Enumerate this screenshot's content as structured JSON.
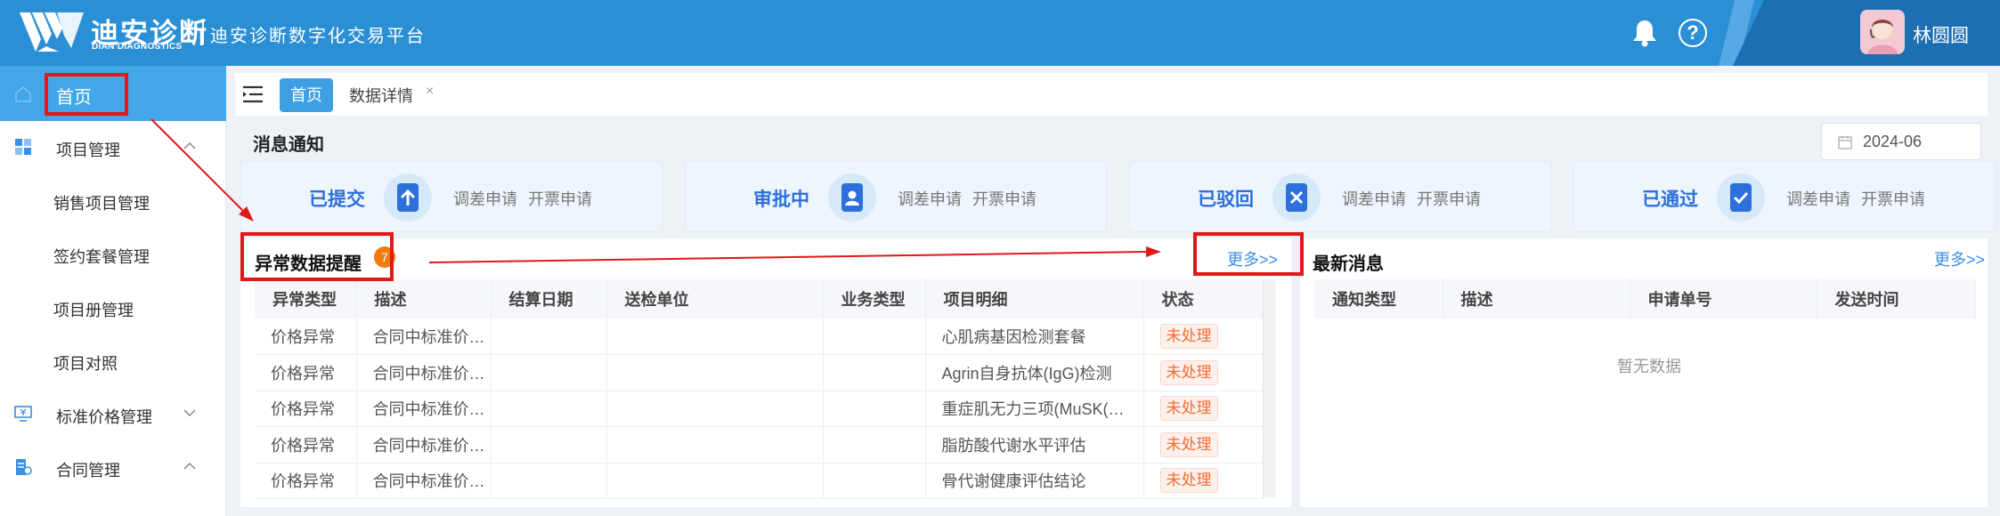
{
  "header": {
    "logo_cn": "迪安诊断",
    "logo_en": "DIAN DIAGNOSTICS",
    "title": "迪安诊断数字化交易平台",
    "user_name": "林圆圆",
    "help_glyph": "?",
    "colors": {
      "header": "#2b8fd6",
      "header_dark": "#1d6fb3",
      "accent": "#3f9fe3"
    }
  },
  "sidebar": {
    "home": "首页",
    "items": [
      {
        "label": "项目管理",
        "icon": "grid-icon",
        "expanded": true
      },
      {
        "label": "销售项目管理"
      },
      {
        "label": "签约套餐管理"
      },
      {
        "label": "项目册管理"
      },
      {
        "label": "项目对照"
      },
      {
        "label": "标准价格管理",
        "icon": "price-icon",
        "expanded": false
      },
      {
        "label": "合同管理",
        "icon": "contract-icon",
        "expanded": true
      }
    ]
  },
  "tabs": [
    {
      "label": "首页",
      "active": true
    },
    {
      "label": "数据详情",
      "close": "×"
    }
  ],
  "messages": {
    "title": "消息通知",
    "date": "2024-06",
    "cards": [
      {
        "label": "已提交",
        "icon": "upload-icon",
        "a": "调差申请",
        "b": "开票申请"
      },
      {
        "label": "审批中",
        "icon": "approver-icon",
        "a": "调差申请",
        "b": "开票申请"
      },
      {
        "label": "已驳回",
        "icon": "reject-icon",
        "a": "调差申请",
        "b": "开票申请"
      },
      {
        "label": "已通过",
        "icon": "approved-icon",
        "a": "调差申请",
        "b": "开票申请"
      }
    ]
  },
  "abnormal": {
    "title": "异常数据提醒",
    "badge": "7",
    "more": "更多>>",
    "columns": [
      "异常类型",
      "描述",
      "结算日期",
      "送检单位",
      "业务类型",
      "项目明细",
      "状态"
    ],
    "rows": [
      [
        "价格异常",
        "合同中标准价格异常",
        "",
        "",
        "",
        "心肌病基因检测套餐",
        "未处理"
      ],
      [
        "价格异常",
        "合同中标准价格异常",
        "",
        "",
        "",
        "Agrin自身抗体(IgG)检测",
        "未处理"
      ],
      [
        "价格异常",
        "合同中标准价格异常",
        "",
        "",
        "",
        "重症肌无力三项(MuSK(…",
        "未处理"
      ],
      [
        "价格异常",
        "合同中标准价格异常",
        "",
        "",
        "",
        "脂肪酸代谢水平评估",
        "未处理"
      ],
      [
        "价格异常",
        "合同中标准价格异常",
        "",
        "",
        "",
        "骨代谢健康评估结论",
        "未处理"
      ]
    ]
  },
  "latest": {
    "title": "最新消息",
    "more": "更多>>",
    "columns": [
      "通知类型",
      "描述",
      "申请单号",
      "发送时间"
    ],
    "empty": "暂无数据"
  },
  "annotation_color": "#e01818"
}
